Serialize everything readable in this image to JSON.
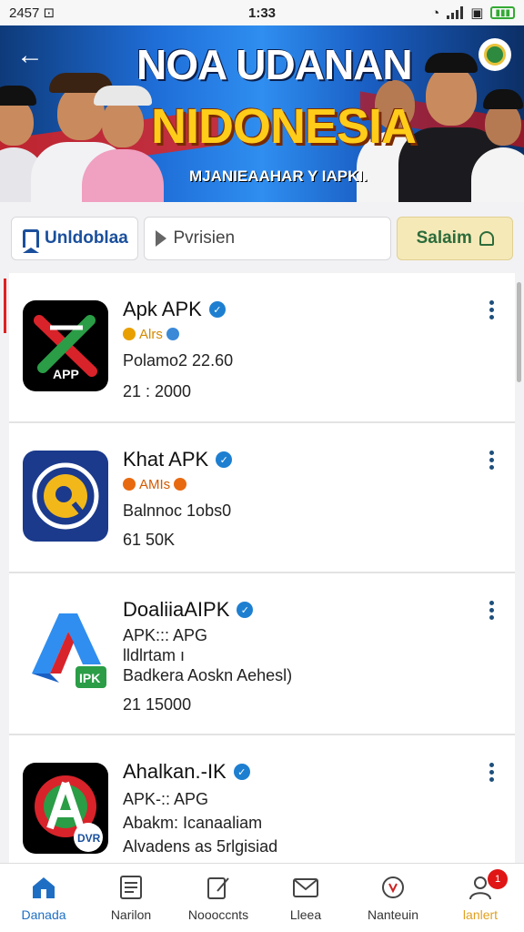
{
  "status_bar": {
    "left": "2457 ⊡",
    "time": "1:33",
    "battery": "▭"
  },
  "banner": {
    "title_line1": "NOA UDANAN",
    "title_line2": "NIDONESIA",
    "subtitle": "MJANIEAAHAR Y IAPKI."
  },
  "tabs": {
    "brand_label": "Unldoblaa",
    "search_placeholder": "Pvrisien",
    "save_label": "Salaim"
  },
  "apps": [
    {
      "name": "Apk APK",
      "meta": "Alrs",
      "line2": "Polamo2 22.60",
      "line3": "21 : 2000",
      "icon_text": "APP",
      "icon_bg": "#000000",
      "meta_color": "#e8a000"
    },
    {
      "name": "Khat APK",
      "meta": "AMIs",
      "line2": "Balnnoc 1obs0",
      "line3": "61 50K",
      "icon_text": "",
      "icon_bg": "#1b3a8c",
      "meta_color": "#e86a10"
    },
    {
      "name": "DoaliiaAIPK",
      "meta": "APK::: APG",
      "line2": "lldlrtam ı",
      "line3": "Badkera Aoskn Aehesl)",
      "line4": "21 15000",
      "icon_text": "IPK",
      "icon_bg": "#ffffff"
    },
    {
      "name": "Ahalkan.-IK",
      "meta": "APK-:: APG",
      "line2": "Abakm: Icanaaliam",
      "line3": "Alvadens as 5rlgisiad",
      "icon_text": "DVR",
      "icon_bg": "#000000"
    }
  ],
  "bottom_nav": [
    {
      "label": "Danada",
      "icon": "home-icon"
    },
    {
      "label": "Narilon",
      "icon": "list-icon"
    },
    {
      "label": "Noooccnts",
      "icon": "document-edit-icon"
    },
    {
      "label": "Lleea",
      "icon": "mail-icon"
    },
    {
      "label": "Nanteuin",
      "icon": "shield-icon"
    },
    {
      "label": "lanlert",
      "icon": "user-icon",
      "badge": "1"
    }
  ]
}
